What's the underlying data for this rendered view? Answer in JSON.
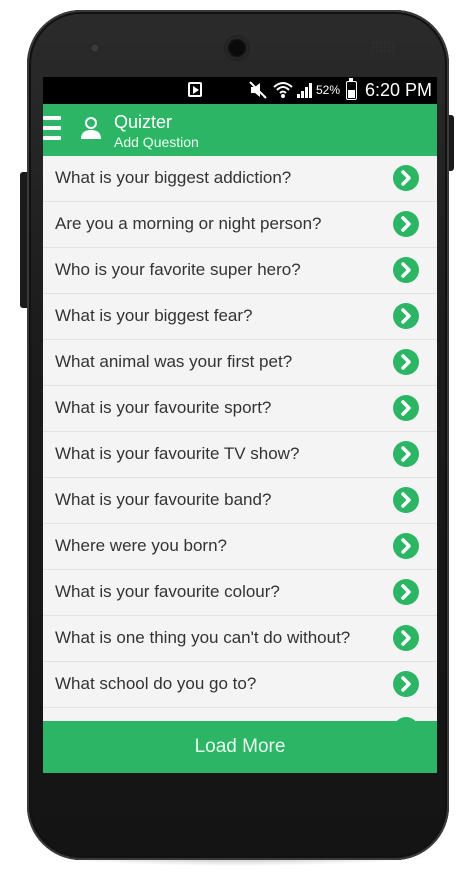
{
  "status_bar": {
    "battery_percent": "52%",
    "time": "6:20 PM",
    "icons": [
      "play-store-notification-icon",
      "mute-icon",
      "wifi-icon",
      "signal-icon",
      "battery-icon"
    ]
  },
  "app_bar": {
    "title": "Quizter",
    "subtitle": "Add Question",
    "icons": [
      "menu-icon",
      "person-icon"
    ]
  },
  "questions": [
    "What is your biggest addiction?",
    "Are you a morning or night person?",
    "Who is your favorite super hero?",
    "What is your biggest fear?",
    "What animal was your first pet?",
    "What is your favourite sport?",
    "What is your favourite TV show?",
    "What is your favourite band?",
    "Where were you born?",
    "What is your favourite colour?",
    "What is one thing you can't do without?",
    "What school do you go to?"
  ],
  "row_action_icon": "chevron-right-circle-icon",
  "load_more_label": "Load More",
  "colors": {
    "accent": "#2db566",
    "status_bar": "#000000",
    "list_background": "#f4f4f4",
    "text": "#333333"
  }
}
